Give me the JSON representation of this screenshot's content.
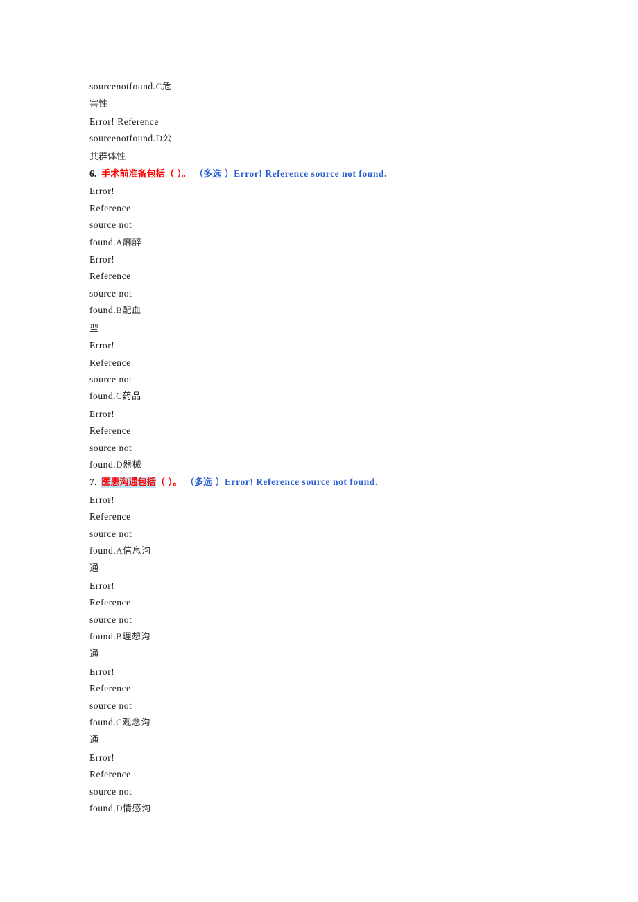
{
  "document": {
    "colors": {
      "question_red": "#ff0000",
      "meta_blue": "#2a5fd4",
      "highlight_cyan": "#bfe4f4",
      "body_text": "#1a1a1a",
      "page_background": "#ffffff"
    },
    "error_text": "Error! Reference source not found.",
    "error_word_1": "Error!",
    "error_word_2": "Reference",
    "error_word_3": "source not",
    "error_word_4": "found.",
    "error_joined_prefix": "Error! Reference",
    "error_joined_suffix": "sourcenotfound.",
    "blocks": [
      {
        "id": "carryover-option-c",
        "kind": "option-carryover",
        "lines": [
          {
            "text": "sourcenotfound.",
            "label": "C",
            "cjk": "危"
          },
          {
            "cjk": "害性"
          }
        ]
      },
      {
        "id": "carryover-option-d",
        "kind": "option-carryover",
        "lines": [
          {
            "text": "Error! Reference"
          },
          {
            "text": "sourcenotfound.",
            "label": "D",
            "cjk": "公"
          },
          {
            "cjk": "共群体性"
          }
        ]
      },
      {
        "id": "question-6",
        "kind": "question",
        "number": "6.",
        "stem": "手术前准备包括",
        "stem_highlighted": false,
        "paren": "（ ）。",
        "type_label": "（多选 ）",
        "error_inline": "Error! Reference source not found.",
        "options": [
          {
            "label": "A",
            "cjk_lines": [
              "麻醉"
            ]
          },
          {
            "label": "B",
            "cjk_lines": [
              "配血",
              "型"
            ]
          },
          {
            "label": "C",
            "cjk_lines": [
              "药品"
            ]
          },
          {
            "label": "D",
            "cjk_lines": [
              "器械"
            ]
          }
        ]
      },
      {
        "id": "question-7",
        "kind": "question",
        "number": "7.",
        "stem": "医患沟通包括",
        "stem_highlighted": true,
        "paren": "（ ）。",
        "type_label": "（多选 ）",
        "error_inline": "Error! Reference source not found.",
        "options": [
          {
            "label": "A",
            "cjk_lines": [
              "信息沟",
              "通"
            ]
          },
          {
            "label": "B",
            "cjk_lines": [
              "理想沟",
              "通"
            ]
          },
          {
            "label": "C",
            "cjk_lines": [
              "观念沟",
              "通"
            ]
          },
          {
            "label": "D",
            "cjk_lines": [
              "情感沟"
            ]
          }
        ]
      }
    ]
  }
}
